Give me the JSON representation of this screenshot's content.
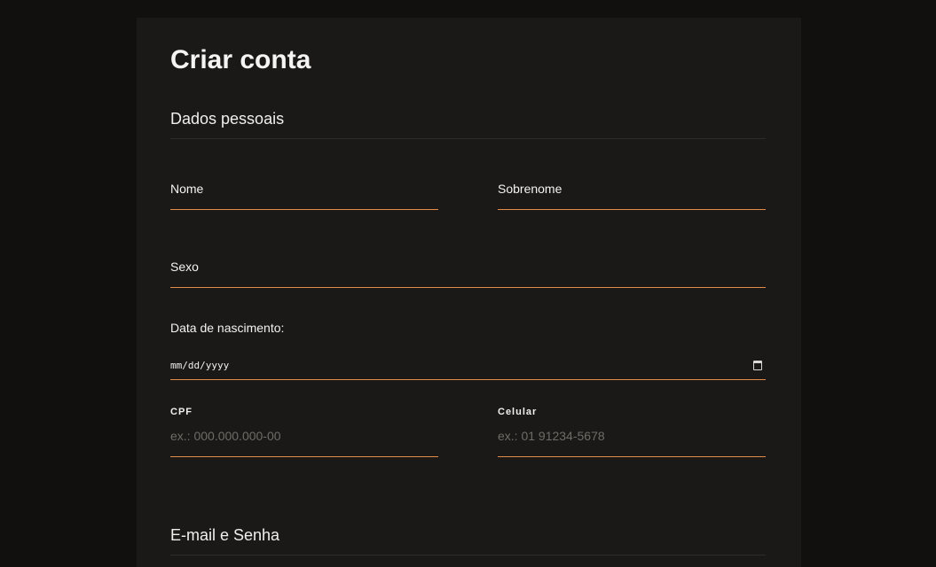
{
  "form": {
    "title": "Criar conta",
    "personal_section": "Dados pessoais",
    "fields": {
      "nome": {
        "label": "Nome",
        "value": ""
      },
      "sobrenome": {
        "label": "Sobrenome",
        "value": ""
      },
      "sexo": {
        "label": "Sexo",
        "value": ""
      },
      "nascimento": {
        "label": "Data de nascimento:",
        "placeholder": "mm/dd/yyyy"
      },
      "cpf": {
        "label": "CPF",
        "placeholder": "ex.: 000.000.000-00"
      },
      "celular": {
        "label": "Celular",
        "placeholder": "ex.: 01 91234-5678"
      }
    },
    "credentials_section": "E-mail e Senha"
  },
  "colors": {
    "page_background": "#12100f",
    "card_background": "#1b1917",
    "accent_underline": "#e28c4a",
    "placeholder": "#6f6b67"
  },
  "icons": {
    "date_picker": "calendar-icon"
  }
}
